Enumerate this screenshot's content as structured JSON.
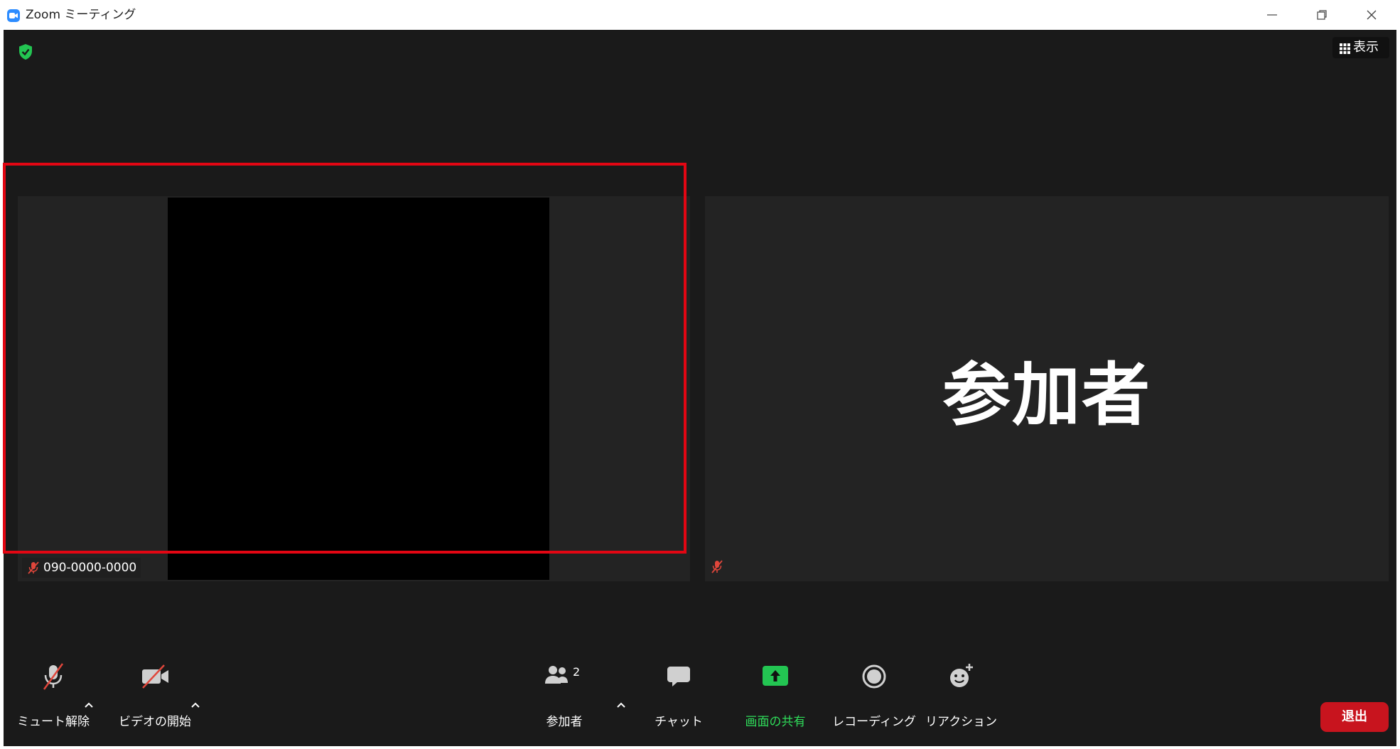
{
  "window": {
    "title": "Zoom ミーティング"
  },
  "top_bar": {
    "view_label": "表示"
  },
  "tiles": {
    "left": {
      "participant_name": "090-0000-0000"
    },
    "right": {
      "display_name": "参加者"
    }
  },
  "toolbar": {
    "unmute_label": "ミュート解除",
    "start_video_label": "ビデオの開始",
    "participants_label": "参加者",
    "participants_count": "2",
    "chat_label": "チャット",
    "share_screen_label": "画面の共有",
    "recording_label": "レコーディング",
    "reaction_label": "リアクション",
    "leave_label": "退出"
  },
  "colors": {
    "accent": "#2d8cff",
    "share_green": "#2fdc5a",
    "leave_red": "#c8141e",
    "highlight_red": "#e30613",
    "muted_red": "#e0463b"
  },
  "icons": {
    "app": "zoom-logo-icon",
    "security": "shield-check-icon",
    "view": "grid-icon",
    "mute": "muted-microphone-icon",
    "video": "video-off-icon",
    "participants": "people-icon",
    "chat": "speech-bubble-icon",
    "share": "share-up-arrow-icon",
    "record": "record-circle-icon",
    "reaction": "smiley-plus-icon"
  }
}
